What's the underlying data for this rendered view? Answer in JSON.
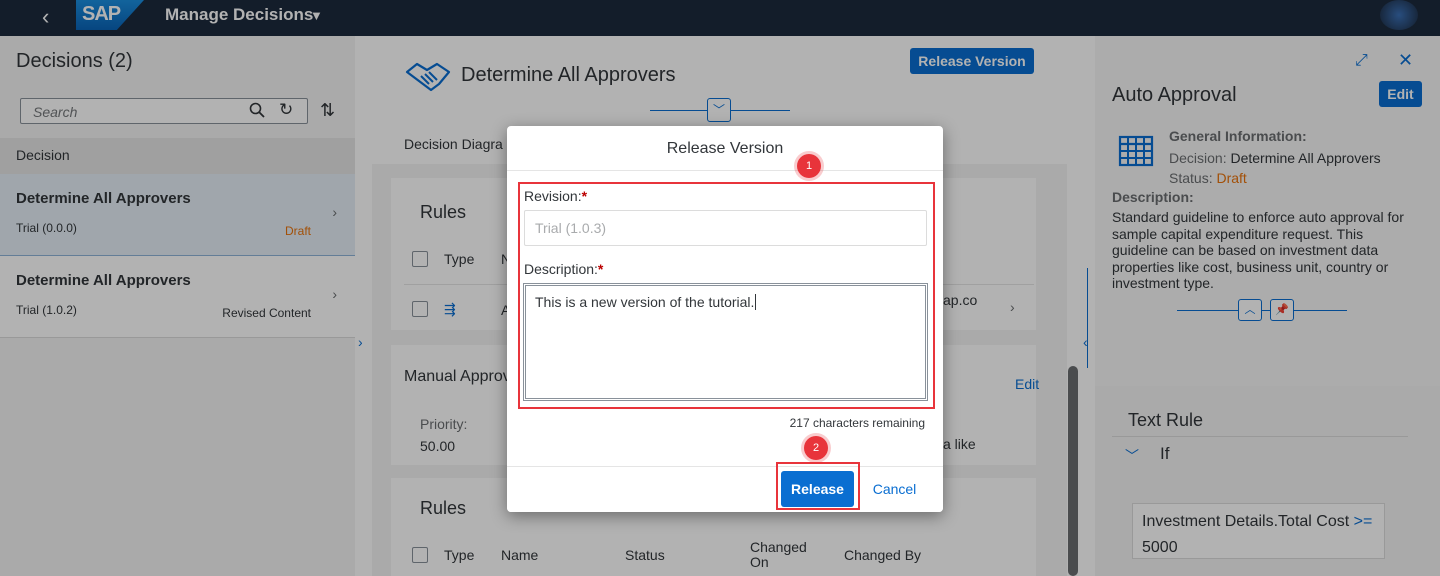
{
  "shell": {
    "app_title": "Manage Decisions",
    "logo": "SAP"
  },
  "left": {
    "title": "Decisions (2)",
    "search_placeholder": "Search",
    "group_header": "Decision",
    "items": [
      {
        "name": "Determine All Approvers",
        "version": "Trial (0.0.0)",
        "status": "Draft"
      },
      {
        "name": "Determine All Approvers",
        "version": "Trial (1.0.2)",
        "status": "Revised Content"
      }
    ]
  },
  "middle": {
    "title": "Determine All Approvers",
    "release_version_button": "Release Version",
    "tab": "Decision Diagra",
    "rules_heading": "Rules",
    "col_type": "Type",
    "col_n_partial": "N",
    "row_partial_a": "A",
    "row_partial_email": "ap.co",
    "manual_approval_partial": "Manual Approv",
    "edit_link": "Edit",
    "priority_label": "Priority:",
    "priority_value": "50.00",
    "partial_text_like": "a like",
    "rules_heading_2": "Rules",
    "cols": [
      "Type",
      "Name",
      "Status",
      "Changed On",
      "Changed By"
    ]
  },
  "right": {
    "title": "Auto Approval",
    "edit_button": "Edit",
    "general_info": "General Information:",
    "decision_label": "Decision:",
    "decision_value": "Determine All Approvers",
    "status_label": "Status:",
    "status_value": "Draft",
    "description_label": "Description:",
    "description": "Standard guideline to enforce auto approval for sample capital expenditure request. This guideline can be based on investment data properties like cost, business unit, country or investment type.",
    "text_rule_heading": "Text Rule",
    "if_label": "If",
    "expr_field": "Investment Details.Total Cost",
    "expr_operator": ">=",
    "expr_value": "5000"
  },
  "dialog": {
    "title": "Release Version",
    "revision_label": "Revision:",
    "revision_value": "Trial (1.0.3)",
    "description_label": "Description:",
    "description_value": "This is a new version of the tutorial.",
    "chars_remaining": "217 characters remaining",
    "release_button": "Release",
    "cancel_button": "Cancel",
    "required_mark": "*",
    "badge_1": "1",
    "badge_2": "2"
  },
  "colors": {
    "shell_bg": "#1c2a3d",
    "accent": "#0a6ed1",
    "draft": "#e9730c",
    "highlight": "#e8343b"
  }
}
